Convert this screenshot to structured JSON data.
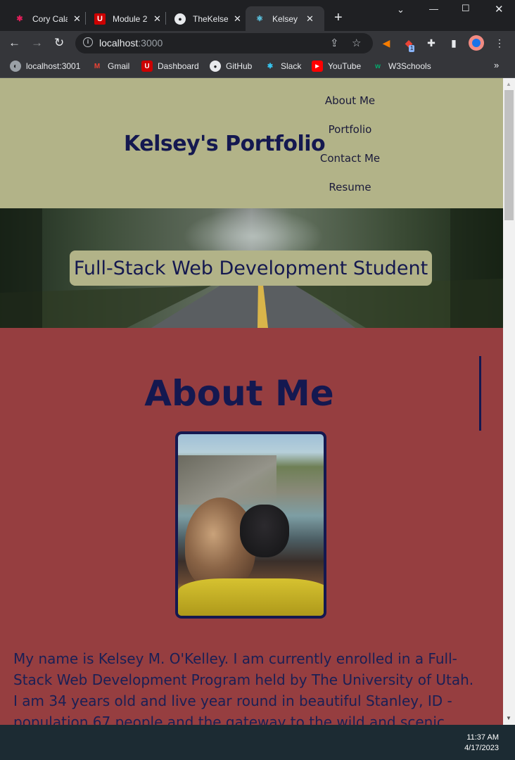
{
  "browser": {
    "tabs": [
      {
        "title": "Cory Calahan",
        "icon": "slack-icon"
      },
      {
        "title": "Module 2",
        "icon": "utah-u-icon"
      },
      {
        "title": "TheKelsey",
        "icon": "github-icon"
      },
      {
        "title": "Kelsey O'Kelley",
        "icon": "react-icon",
        "active": true
      }
    ],
    "url_host": "localhost",
    "url_port": ":3000",
    "bookmarks": [
      {
        "label": "localhost:3001",
        "icon": "globe-icon"
      },
      {
        "label": "Gmail",
        "icon": "gmail-icon"
      },
      {
        "label": "Dashboard",
        "icon": "utah-u-icon"
      },
      {
        "label": "GitHub",
        "icon": "github-icon"
      },
      {
        "label": "Slack",
        "icon": "slack-icon"
      },
      {
        "label": "YouTube",
        "icon": "youtube-icon"
      },
      {
        "label": "W3Schools",
        "icon": "w3schools-icon"
      }
    ],
    "extension_badge": "1"
  },
  "site": {
    "title": "Kelsey's Portfolio",
    "nav": [
      "About Me",
      "Portfolio",
      "Contact Me",
      "Resume"
    ],
    "hero_banner": "Full-Stack Web Development Student",
    "about": {
      "heading": "About Me",
      "bio": "My name is Kelsey M. O'Kelley. I am currently enrolled in a Full-Stack Web Development Program held by The University of Utah. I am 34 years old and live year round in beautiful Stanley, ID - population 67 people and the gateway to the wild and scenic Frank"
    }
  },
  "taskbar": {
    "time": "11:37 AM",
    "date": "4/17/2023"
  },
  "colors": {
    "header_bg": "#b2b388",
    "section_bg": "#963e40",
    "heading_text": "#141850"
  }
}
